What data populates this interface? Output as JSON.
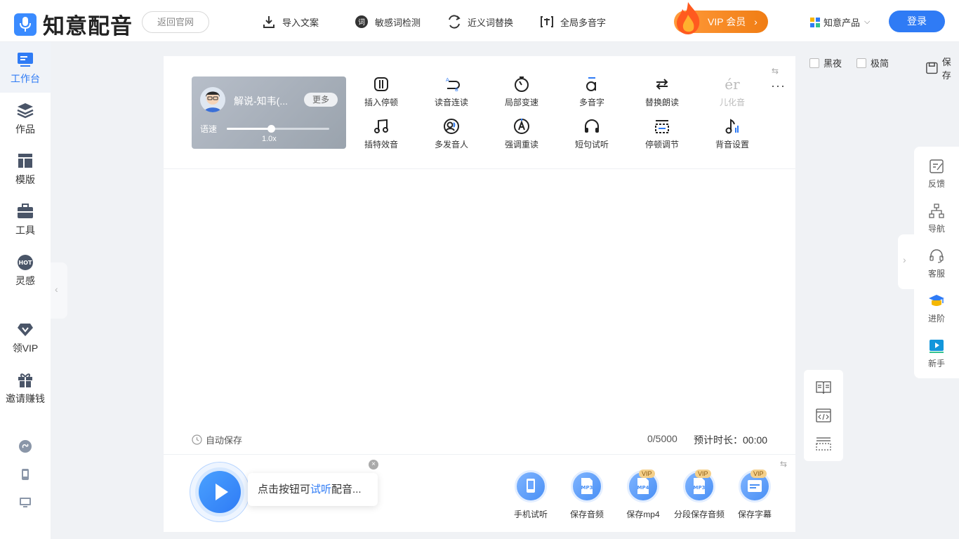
{
  "header": {
    "app_name": "知意配音",
    "back_label": "返回官网",
    "nav": [
      {
        "label": "导入文案",
        "icon": "import-icon"
      },
      {
        "label": "敏感词检测",
        "icon": "sensitive-word-icon"
      },
      {
        "label": "近义词替换",
        "icon": "synonym-icon"
      },
      {
        "label": "全局多音字",
        "icon": "polyphone-icon"
      }
    ],
    "vip_label": "VIP 会员",
    "products_label": "知意产品",
    "login_label": "登录"
  },
  "sidebar": {
    "items": [
      {
        "label": "工作台",
        "icon": "workbench-icon"
      },
      {
        "label": "作品",
        "icon": "works-icon"
      },
      {
        "label": "模版",
        "icon": "template-icon"
      },
      {
        "label": "工具",
        "icon": "toolbox-icon"
      },
      {
        "label": "灵感",
        "icon": "hot-icon"
      },
      {
        "label": "领VIP",
        "icon": "diamond-icon"
      },
      {
        "label": "邀请赚钱",
        "icon": "gift-icon"
      }
    ]
  },
  "voice": {
    "name": "解说-知韦(...",
    "more_label": "更多",
    "speed_label": "语速",
    "speed_value": "1.0x",
    "speed_fraction": 0.43
  },
  "tools": [
    {
      "label": "插入停顿",
      "icon": "pause-insert-icon"
    },
    {
      "label": "读音连读",
      "icon": "liaison-icon"
    },
    {
      "label": "局部变速",
      "icon": "speed-change-icon"
    },
    {
      "label": "多音字",
      "icon": "polyphone-char-icon"
    },
    {
      "label": "替换朗读",
      "icon": "replace-read-icon"
    },
    {
      "label": "儿化音",
      "icon": "erhua-icon",
      "glyph": "ér"
    },
    {
      "label": "插特效音",
      "icon": "sound-effect-icon"
    },
    {
      "label": "多发音人",
      "icon": "multi-speaker-icon"
    },
    {
      "label": "强调重读",
      "icon": "emphasis-icon"
    },
    {
      "label": "短句试听",
      "icon": "headphones-icon"
    },
    {
      "label": "停顿调节",
      "icon": "pause-adjust-icon"
    },
    {
      "label": "背音设置",
      "icon": "bgm-icon"
    }
  ],
  "editor": {
    "autosave_label": "自动保存",
    "counter": "0/5000",
    "duration": "预计时长：00:00"
  },
  "player": {
    "tip_before": "点击按钮可",
    "tip_highlight": "试听",
    "tip_after": "配音..."
  },
  "save_actions": [
    {
      "label": "手机试听",
      "icon": "phone-icon",
      "vip": false
    },
    {
      "label": "保存音频",
      "icon": "mp3-icon",
      "badge": "MP3",
      "vip": false
    },
    {
      "label": "保存mp4",
      "icon": "mp4-icon",
      "badge": "MP4",
      "vip": true
    },
    {
      "label": "分段保存音频",
      "icon": "mp3-segment-icon",
      "badge": "MP3",
      "vip": true
    },
    {
      "label": "保存字幕",
      "icon": "subtitle-icon",
      "vip": true
    }
  ],
  "vip_tag": "VIP",
  "options": {
    "dark_label": "黑夜",
    "simple_label": "极简",
    "save_label": "保存"
  },
  "right_panel": [
    {
      "label": "反馈",
      "icon": "feedback-icon"
    },
    {
      "label": "导航",
      "icon": "navigation-icon"
    },
    {
      "label": "客服",
      "icon": "customer-service-icon"
    },
    {
      "label": "进阶",
      "icon": "graduation-icon"
    },
    {
      "label": "新手",
      "icon": "beginner-video-icon"
    }
  ],
  "colors": {
    "accent": "#2f7bf5",
    "vip": "#f07d14"
  }
}
